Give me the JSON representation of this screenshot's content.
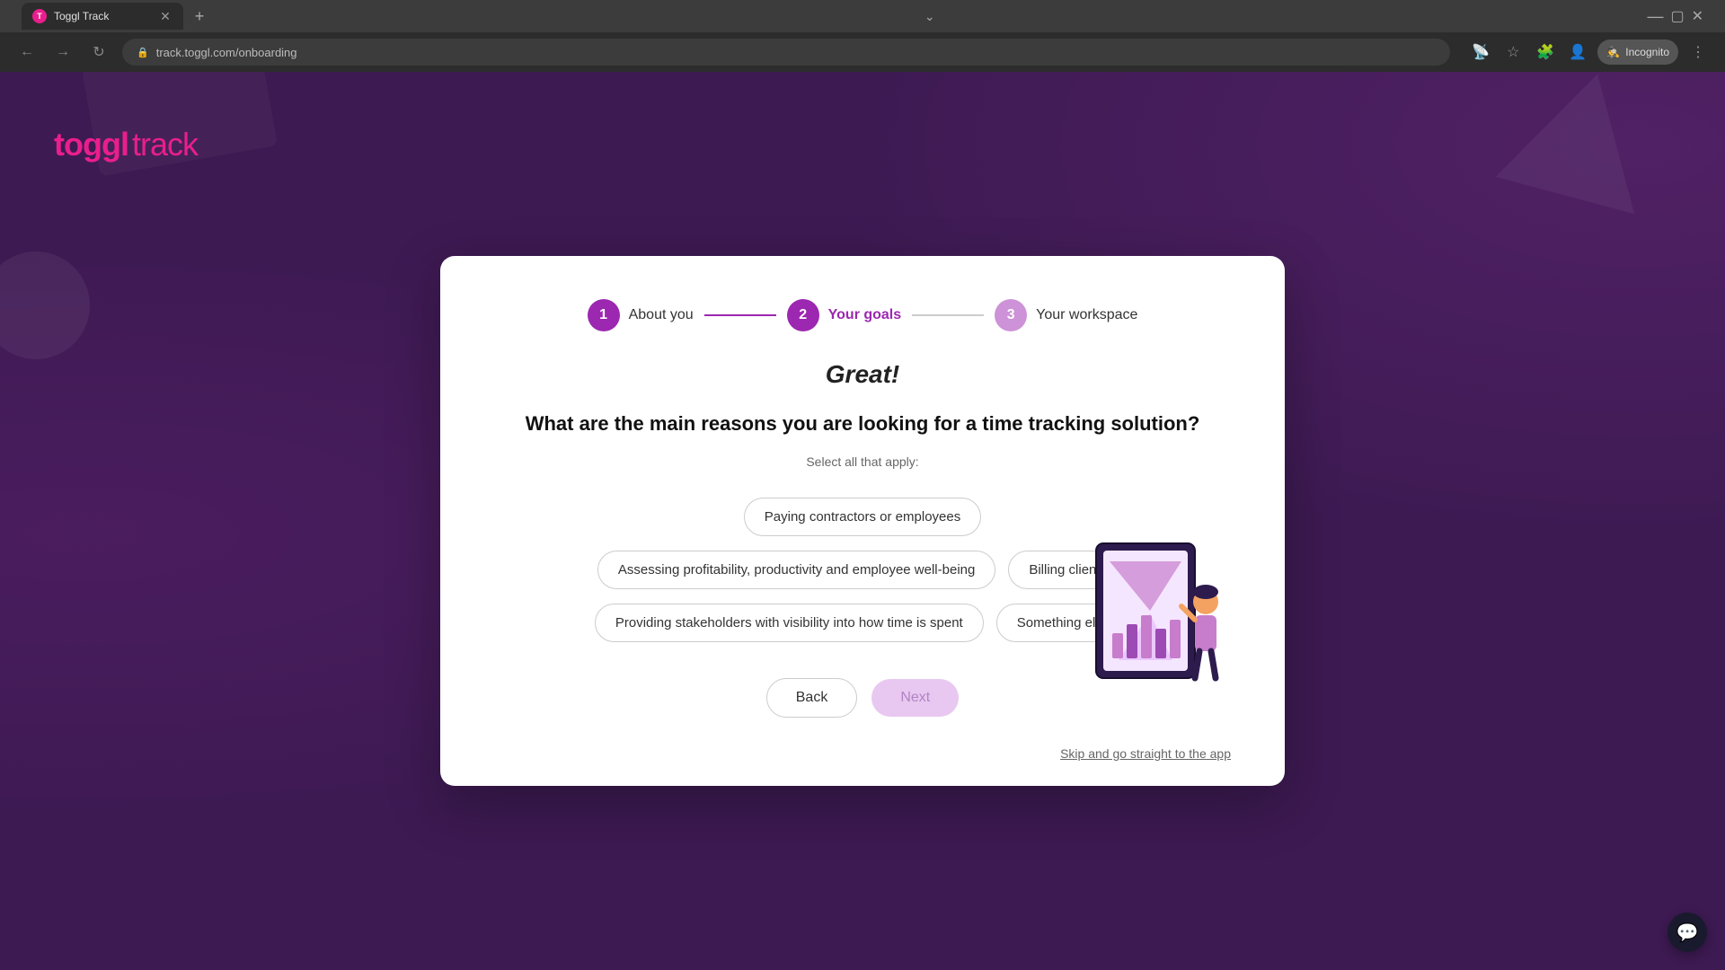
{
  "browser": {
    "tab_title": "Toggl Track",
    "url": "track.toggl.com/onboarding",
    "new_tab_label": "+",
    "incognito_label": "Incognito",
    "nav": {
      "back_disabled": true,
      "forward_disabled": true
    }
  },
  "logo": {
    "toggl": "toggl",
    "track": " track"
  },
  "stepper": {
    "steps": [
      {
        "number": "1",
        "label": "About you",
        "state": "done"
      },
      {
        "number": "2",
        "label": "Your goals",
        "state": "active"
      },
      {
        "number": "3",
        "label": "Your workspace",
        "state": "inactive"
      }
    ],
    "connectors": [
      "done",
      "pending"
    ]
  },
  "modal": {
    "title": "Great!",
    "question": "What are the main reasons you are looking for a time tracking solution?",
    "subtitle": "Select all that apply:",
    "options": [
      {
        "id": "contractors",
        "label": "Paying contractors or employees",
        "selected": false
      },
      {
        "id": "profitability",
        "label": "Assessing profitability, productivity and employee well-being",
        "selected": false
      },
      {
        "id": "billing",
        "label": "Billing clients",
        "selected": false
      },
      {
        "id": "stakeholders",
        "label": "Providing stakeholders with visibility into how time is spent",
        "selected": false
      },
      {
        "id": "something_else",
        "label": "Something else",
        "selected": false
      }
    ],
    "back_label": "Back",
    "next_label": "Next",
    "skip_label": "Skip and go straight to the app"
  }
}
